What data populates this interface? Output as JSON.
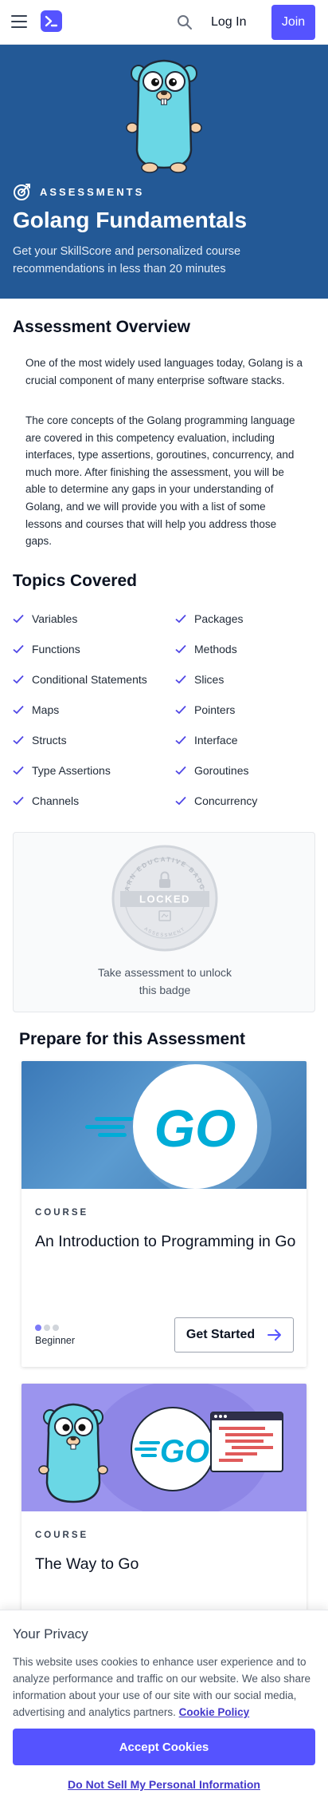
{
  "header": {
    "login_label": "Log In",
    "join_label": "Join",
    "icons": [
      "menu-icon",
      "brand-logo-icon",
      "search-icon"
    ]
  },
  "hero": {
    "eyebrow": "ASSESSMENTS",
    "title": "Golang Fundamentals",
    "subtitle": "Get your SkillScore and personalized course recommendations in less than 20 minutes",
    "background": "#235996"
  },
  "overview": {
    "heading": "Assessment Overview",
    "paragraphs": [
      "One of the most widely used languages today, Golang is a crucial component of many enterprise software stacks.",
      "The core concepts of the Golang programming language are covered in this competency evaluation, including interfaces, type assertions, goroutines, concurrency, and much more. After finishing the assessment, you will be able to determine any gaps in your understanding of Golang, and we will provide you with a list of some lessons and courses that will help you address those gaps."
    ]
  },
  "topics": {
    "heading": "Topics Covered",
    "items": [
      "Variables",
      "Packages",
      "Functions",
      "Methods",
      "Conditional Statements",
      "Slices",
      "Maps",
      "Pointers",
      "Structs",
      "Interface",
      "Type Assertions",
      "Goroutines",
      "Channels",
      "Concurrency"
    ]
  },
  "badge": {
    "ring_text": "EARN EDUCATIVE BADGE",
    "ring_bottom": "ASSESSMENT",
    "status": "LOCKED",
    "caption_line1": "Take assessment to unlock",
    "caption_line2": "this badge"
  },
  "prepare": {
    "heading": "Prepare for this Assessment",
    "courses": [
      {
        "kind": "COURSE",
        "title": "An Introduction to Programming in Go",
        "level": "Beginner",
        "level_value": 1,
        "level_max": 3,
        "cta": "Get Started",
        "image_text": "GO"
      },
      {
        "kind": "COURSE",
        "title": "The Way to Go",
        "image_text": "GO"
      }
    ]
  },
  "privacy": {
    "title": "Your Privacy",
    "text": "This website uses cookies to enhance user experience and to analyze performance and traffic on our website. We also share information about your use of our site with our social media, advertising and analytics partners.",
    "link": "Cookie Policy",
    "accept_label": "Accept Cookies",
    "dnsm_label": "Do Not Sell My Personal Information"
  },
  "colors": {
    "brand": "#5553ff",
    "hero": "#235996",
    "check": "#4f46e5"
  }
}
